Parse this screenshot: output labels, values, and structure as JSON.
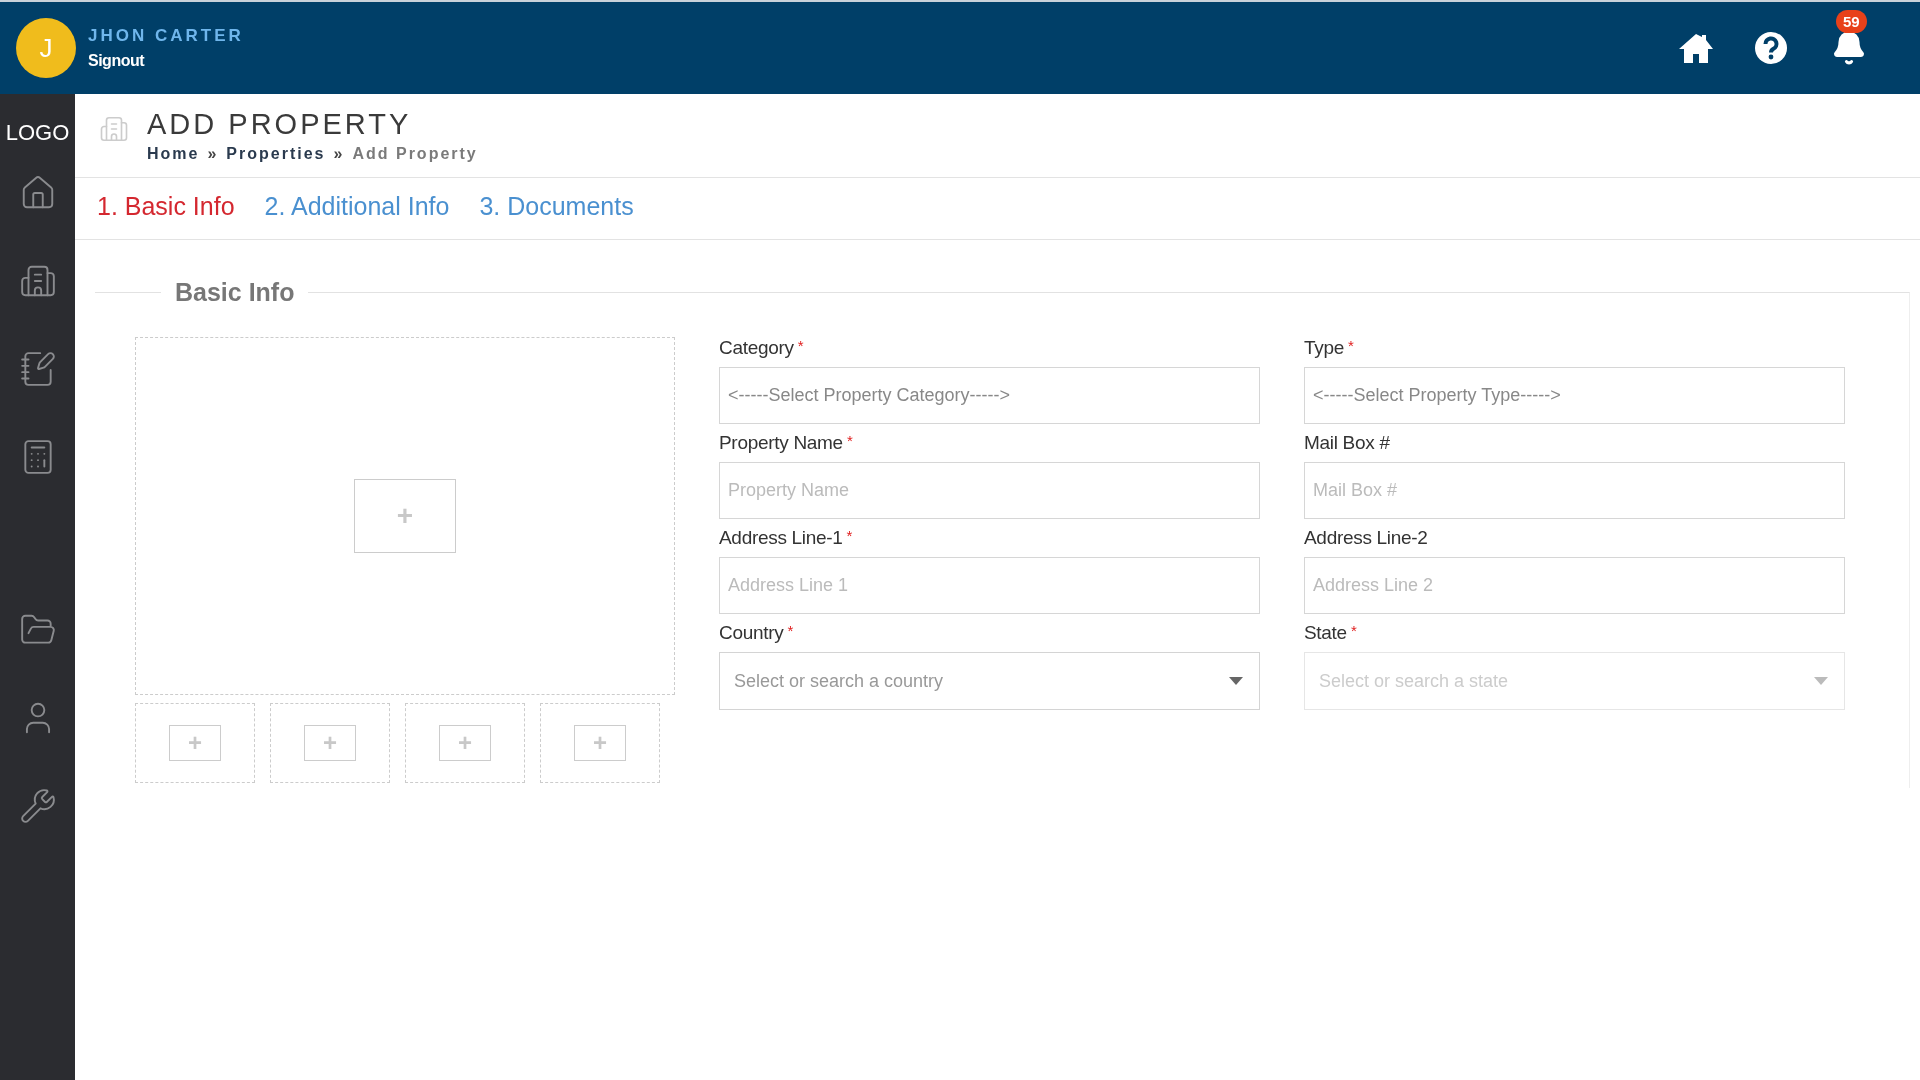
{
  "header": {
    "avatar_initial": "J",
    "user_name": "JHON CARTER",
    "signout": "Signout",
    "notification_count": "59"
  },
  "sidebar": {
    "logo": "LOGO"
  },
  "page": {
    "title": "ADD PROPERTY",
    "breadcrumb": [
      {
        "label": "Home",
        "current": false
      },
      {
        "label": "Properties",
        "current": false
      },
      {
        "label": "Add Property",
        "current": true
      }
    ],
    "separator": "»"
  },
  "tabs": [
    {
      "label": "1. Basic Info",
      "selected": true
    },
    {
      "label": "2. Additional Info",
      "selected": false
    },
    {
      "label": "3. Documents",
      "selected": false
    }
  ],
  "section": {
    "legend": "Basic Info",
    "main_image": {
      "add": "+"
    },
    "thumbnails": [
      {
        "add": "+"
      },
      {
        "add": "+"
      },
      {
        "add": "+"
      },
      {
        "add": "+"
      }
    ]
  },
  "fields": [
    {
      "label": "Category",
      "mark": "*",
      "kind": "select",
      "placeholder": "<-----Select Property Category----->",
      "disabled": false
    },
    {
      "label": "Type",
      "mark": "*",
      "kind": "select",
      "placeholder": "<-----Select Property Type----->",
      "disabled": false
    },
    {
      "label": "Property Name",
      "mark": "*",
      "kind": "input",
      "placeholder": "Property Name",
      "disabled": false
    },
    {
      "label": "Mail Box #",
      "kind": "input",
      "placeholder": "Mail Box #",
      "disabled": false
    },
    {
      "label": "Address Line-1",
      "mark": "*",
      "kind": "input",
      "placeholder": "Address Line 1",
      "disabled": false
    },
    {
      "label": "Address Line-2",
      "kind": "input",
      "placeholder": "Address Line 2",
      "disabled": false
    },
    {
      "label": "Country",
      "mark": "*",
      "kind": "dropdown",
      "placeholder": "Select or search a country",
      "disabled": false
    },
    {
      "label": "State",
      "mark": "*",
      "kind": "dropdown",
      "placeholder": "Select or search a state",
      "disabled": true
    }
  ]
}
